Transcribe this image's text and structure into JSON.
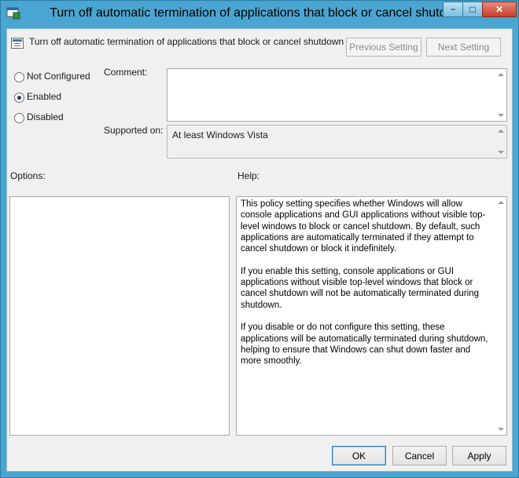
{
  "window": {
    "title": "Turn off automatic termination of applications that block or cancel shutdown",
    "caption_buttons": {
      "minimize": "−",
      "maximize": "□",
      "close": "✕"
    }
  },
  "header": {
    "policy_name": "Turn off automatic termination of applications that block or cancel shutdown",
    "previous_label": "Previous Setting",
    "next_label": "Next Setting"
  },
  "state": {
    "options": [
      {
        "label": "Not Configured",
        "checked": false
      },
      {
        "label": "Enabled",
        "checked": true
      },
      {
        "label": "Disabled",
        "checked": false
      }
    ]
  },
  "comment": {
    "label": "Comment:",
    "value": ""
  },
  "supported": {
    "label": "Supported on:",
    "value": "At least Windows Vista"
  },
  "options_panel": {
    "label": "Options:"
  },
  "help": {
    "label": "Help:",
    "paragraphs": [
      "This policy setting specifies whether Windows will allow console applications and GUI applications without visible top-level windows to block or cancel shutdown. By default, such applications are automatically terminated if they attempt to cancel shutdown or block it indefinitely.",
      "If you enable this setting, console applications or GUI applications without visible top-level windows that block or cancel shutdown will not be automatically terminated during shutdown.",
      "If you disable or do not configure this setting, these applications will be automatically terminated during shutdown, helping to ensure that Windows can shut down faster and more smoothly."
    ]
  },
  "footer": {
    "ok_label": "OK",
    "cancel_label": "Cancel",
    "apply_label": "Apply"
  },
  "colors": {
    "frame": "#4aa6d0",
    "client": "#f0f0f0",
    "close_button": "#c7402c"
  }
}
